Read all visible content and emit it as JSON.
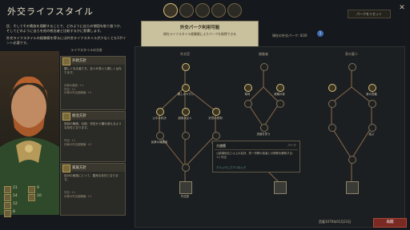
{
  "header": {
    "title": "外交ライフスタイル",
    "reset_label": "パークをリセット"
  },
  "intro": {
    "line1": "民、そしてその貴族を理解することで、どのように自らの領国を取り扱うか、そしてどのように自らを他の統治者と比較するかに影響します。",
    "line2": "外交ライフスタイルの経験値を得るには外交ライフスタイルが少なくとも1ポイント必要です。",
    "panel_title": "ライフスタイルの方針"
  },
  "focuses": [
    {
      "name": "外政方針",
      "desc": "親しくなる者たち、友人が多いと親しくはなります。",
      "stats": "月毎の威信: +1\n外交: +1\n月毎の外交経験値: +2"
    },
    {
      "name": "統治方針",
      "desc": "宮廷の権威、伝統、安定から離れ使えるような存在となります。",
      "stats": "外交: +1\n月毎の外交経験値: +2"
    },
    {
      "name": "家族方針",
      "desc": "自分の家族にとって、善良な存在となります。",
      "stats": "外交: +1\n月毎の外交経験値: +2"
    }
  ],
  "stats": [
    {
      "icon": "diplomacy-icon",
      "value": "21"
    },
    {
      "icon": "stewardship-icon",
      "value": "14"
    },
    {
      "icon": "learning-icon",
      "value": "12"
    },
    {
      "icon": "prowess-icon",
      "value": "8"
    },
    {
      "icon": "intrigue-icon",
      "value": "9"
    },
    {
      "icon": "martial-icon",
      "value": "10"
    }
  ],
  "banner": {
    "title": "外交パーク利用可能",
    "desc": "現在ライフスタイル経験値によりパークを取得できる"
  },
  "perk_count": "現在の外交パーク: 0/20",
  "perk_badge": "1",
  "columns": [
    "外交官",
    "後継者",
    "家の要人"
  ],
  "nodes": [
    {
      "label": "親しみやすい",
      "on": true
    },
    {
      "label": "公平な判決",
      "on": true
    },
    {
      "label": "誠実な友人",
      "on": true
    },
    {
      "label": "好意の表明",
      "on": true
    },
    {
      "label": "民衆の擁護者",
      "on": false
    },
    {
      "label": "大使館",
      "on": false
    },
    {
      "label": "外交官",
      "on": false
    },
    {
      "label": "祭司",
      "on": true
    },
    {
      "label": "政略の家",
      "on": true
    },
    {
      "label": "忠誠を誓う",
      "on": false
    },
    {
      "label": "家の意義",
      "on": true
    },
    {
      "label": "結ぶ",
      "on": false
    }
  ],
  "tooltip": {
    "title": "大使館",
    "kind": "パーク",
    "body": "公爵領地位と以上の友好、同一宗教の信者との関係を解除する：+1 外交",
    "hint": "クリックしてアンロック"
  },
  "footer": {
    "date": "西暦1070年01月23日",
    "resume": "再開"
  }
}
